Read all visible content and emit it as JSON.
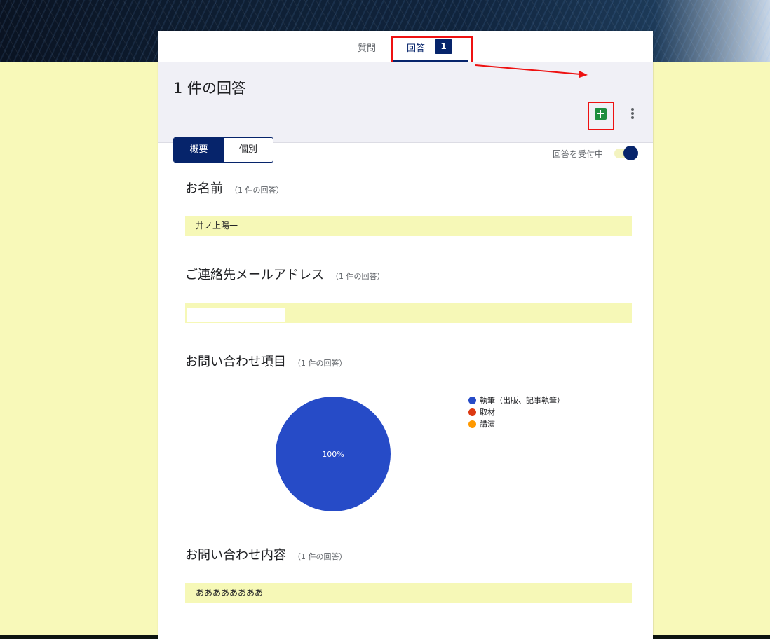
{
  "tabs": {
    "questions_label": "質問",
    "responses_label": "回答",
    "responses_count": "1"
  },
  "summary": {
    "title": "1 件の回答",
    "overview_label": "概要",
    "individual_label": "個別",
    "accepting_label": "回答を受付中",
    "accepting_on": true
  },
  "icons": {
    "sheets": "google-sheets-icon",
    "more": "more-vert-icon"
  },
  "questions": [
    {
      "title": "お名前",
      "count": "（1 件の回答）",
      "answer": "井ノ上陽一"
    },
    {
      "title": "ご連絡先メールアドレス",
      "count": "（1 件の回答）",
      "answer": ""
    },
    {
      "title": "お問い合わせ項目",
      "count": "（1 件の回答）"
    },
    {
      "title": "お問い合わせ内容",
      "count": "（1 件の回答）",
      "answer": "ああああああああ"
    }
  ],
  "chart_data": {
    "type": "pie",
    "labels": [
      "執筆（出版、記事執筆）",
      "取材",
      "講演"
    ],
    "values": [
      100,
      0,
      0
    ],
    "colors": [
      "#264bc7",
      "#dc3912",
      "#ff9900"
    ],
    "slice_label": "100%",
    "legend_position": "right"
  },
  "colors": {
    "accent": "#06246b",
    "highlight": "#e11111",
    "answer_bg": "#f6f8b7"
  }
}
